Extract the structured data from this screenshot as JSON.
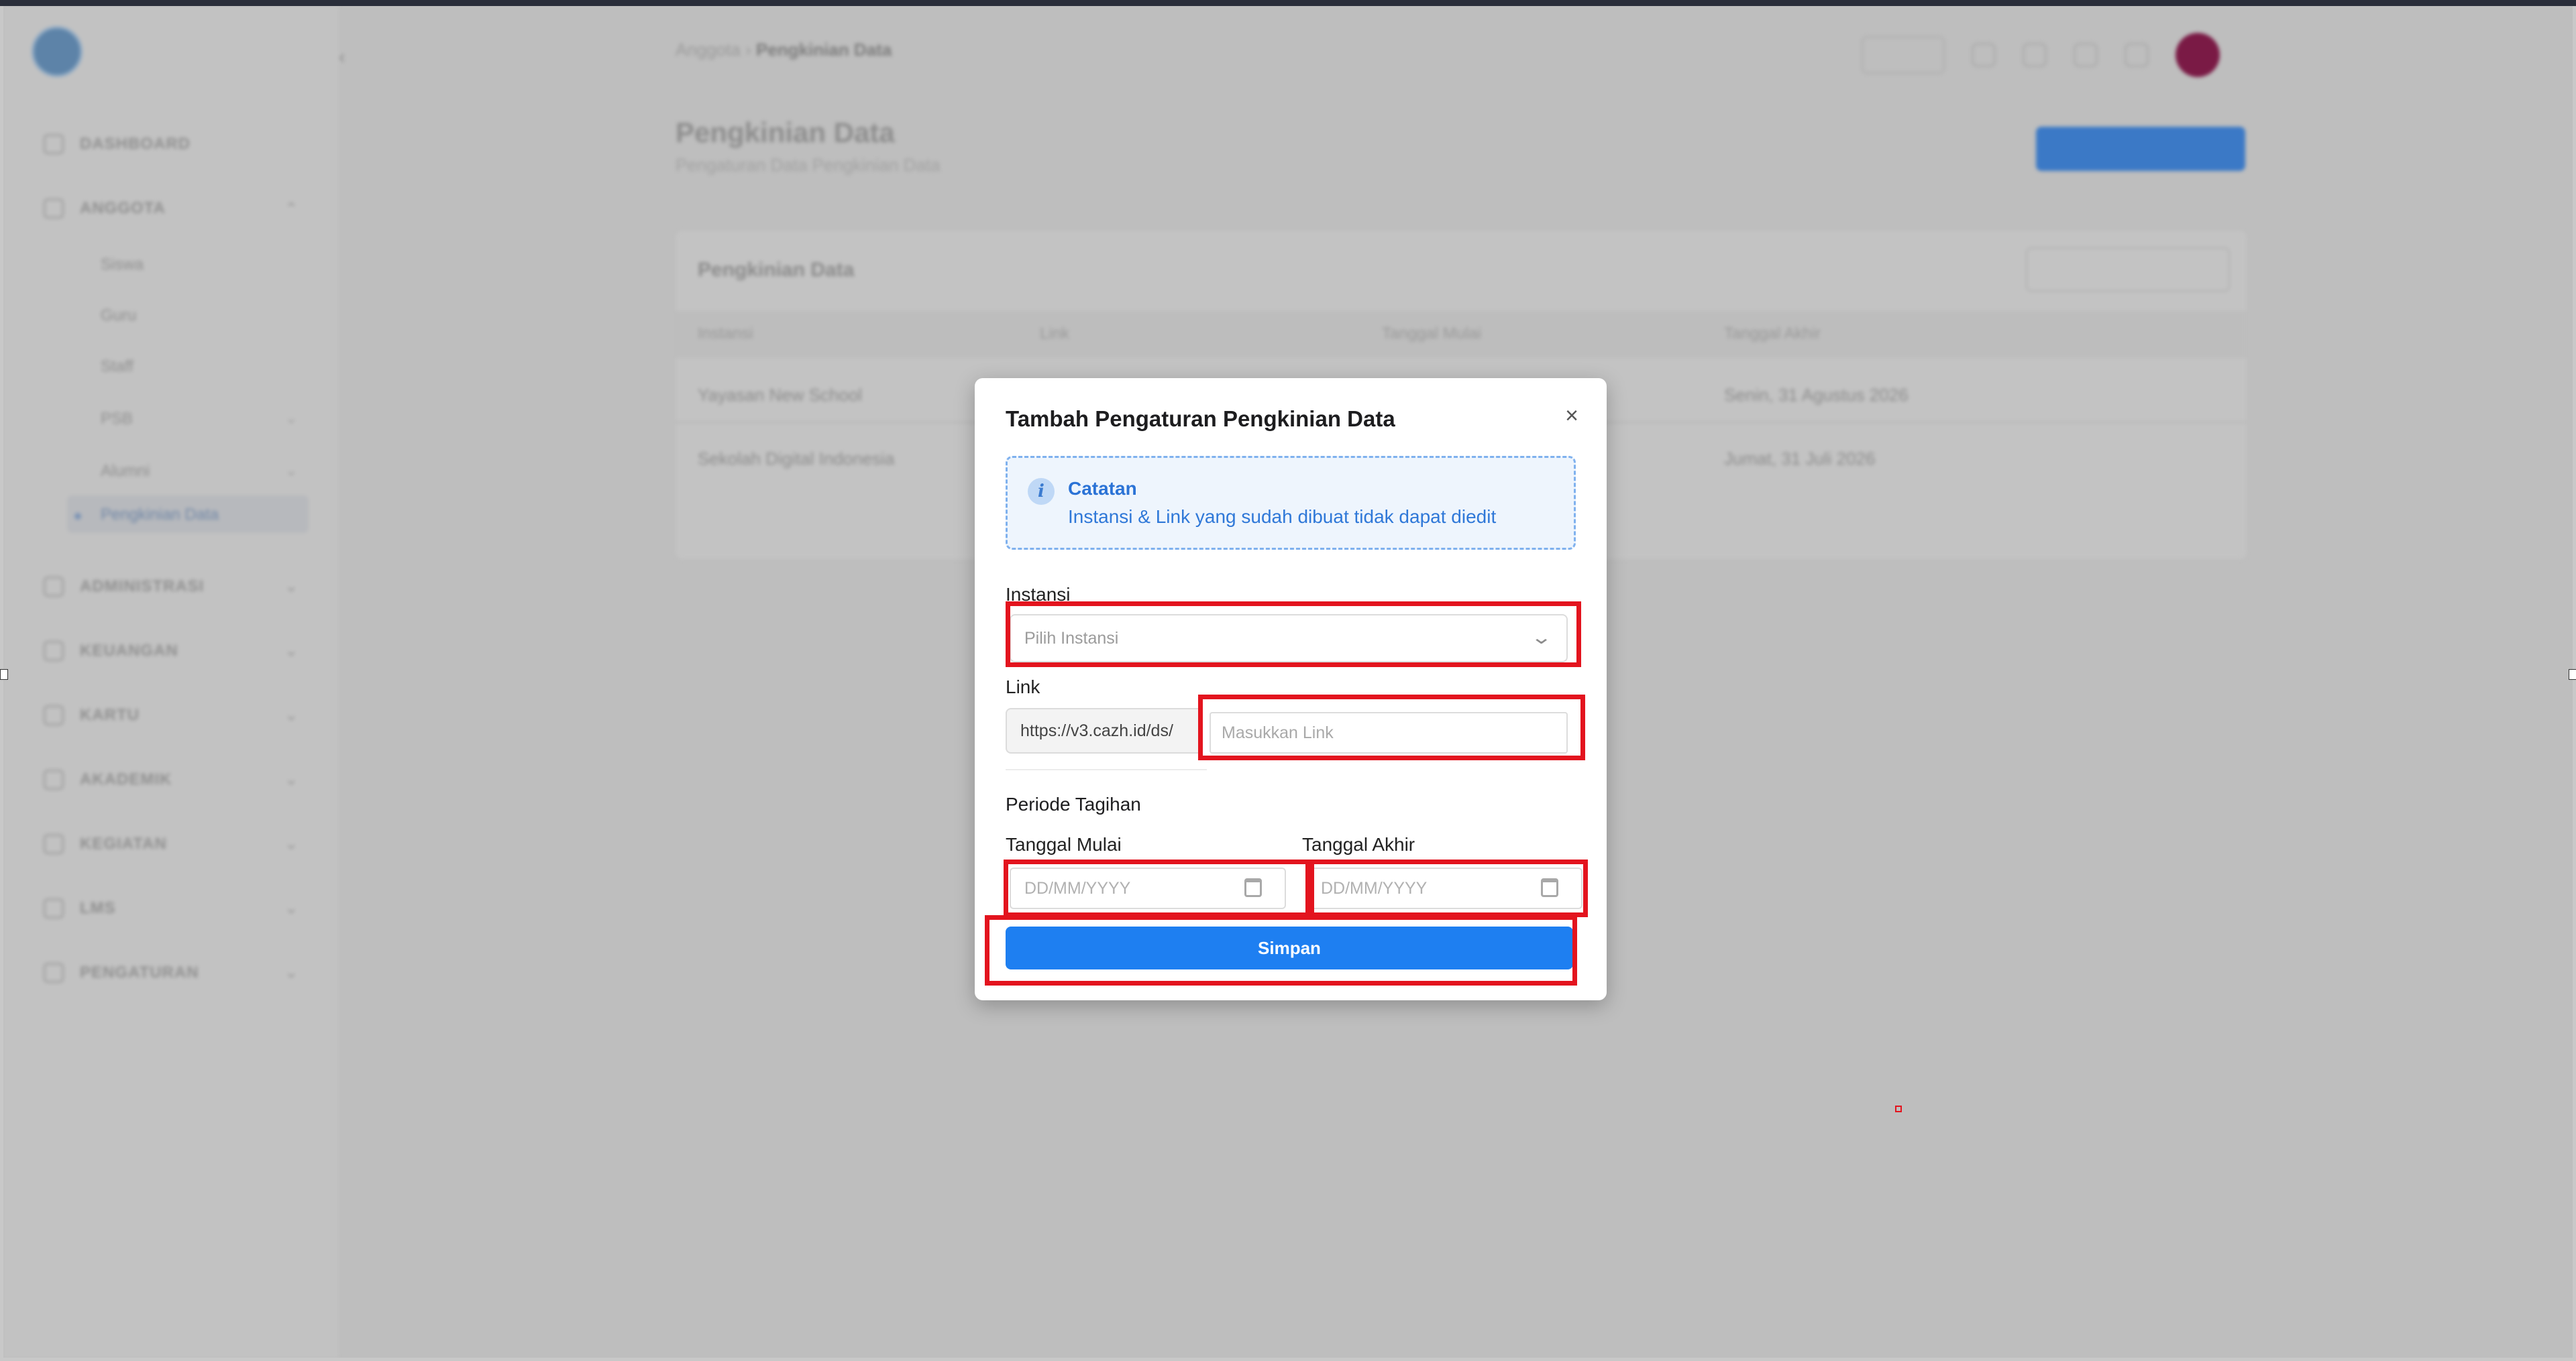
{
  "background": {
    "breadcrumb": {
      "parent": "Anggota",
      "current": "Pengkinian Data"
    },
    "sidebar": {
      "items": [
        "DASHBOARD",
        "ANGGOTA",
        "ADMINISTRASI",
        "KEUANGAN",
        "KARTU",
        "AKADEMIK",
        "KEGIATAN",
        "LMS",
        "PENGATURAN"
      ],
      "sub_items": [
        "Siswa",
        "Guru",
        "Staff",
        "PSB",
        "Alumni"
      ],
      "active": "Pengkinian Data"
    },
    "page_title": "Pengkinian Data",
    "page_subtitle": "Pengaturan Data Pengkinian Data",
    "card_title": "Pengkinian Data",
    "columns": [
      "Instansi",
      "Link",
      "Tanggal Mulai",
      "Tanggal Akhir"
    ],
    "rows": [
      {
        "instansi": "Yayasan New School",
        "tanggal_akhir": "Senin, 31 Agustus 2026"
      },
      {
        "instansi": "Sekolah Digital Indonesia",
        "tanggal_akhir": "Jumat, 31 Juli 2026"
      }
    ]
  },
  "modal": {
    "title": "Tambah Pengaturan Pengkinian Data",
    "close_icon": "close-icon",
    "note": {
      "icon": "info-icon",
      "title": "Catatan",
      "text": "Instansi & Link yang sudah dibuat tidak dapat diedit"
    },
    "instansi": {
      "label": "Instansi",
      "placeholder": "Pilih Instansi",
      "chevron": "chevron-down-icon"
    },
    "link": {
      "label": "Link",
      "prefix": "https://v3.cazh.id/ds/",
      "placeholder": "Masukkan Link"
    },
    "periode": {
      "title": "Periode Tagihan",
      "start_label": "Tanggal Mulai",
      "end_label": "Tanggal Akhir",
      "date_placeholder": "DD/MM/YYYY",
      "icon": "calendar-icon"
    },
    "submit_label": "Simpan"
  },
  "colors": {
    "primary": "#1e7ff1",
    "highlight": "#e3141e",
    "note_bg": "#eef5fd",
    "note_text": "#2f78d8",
    "avatar": "#7a1a45"
  }
}
